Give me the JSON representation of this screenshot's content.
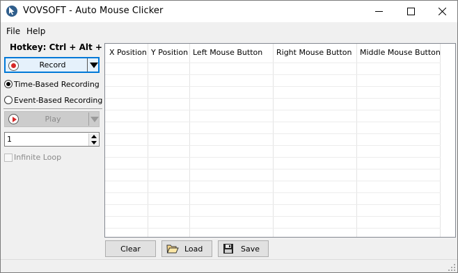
{
  "window": {
    "title": "VOVSOFT - Auto Mouse Clicker",
    "icon": "cursor-app-icon",
    "controls": [
      "minimize-icon",
      "maximize-icon",
      "close-icon"
    ]
  },
  "menu": {
    "file": "File",
    "help": "Help"
  },
  "left_panel": {
    "hotkey": "Hotkey: Ctrl + Alt + V",
    "record_label": "Record",
    "time_based": "Time-Based Recording",
    "event_based": "Event-Based Recording",
    "selected_mode": "Time-Based Recording",
    "play_label": "Play",
    "repeat_value": "1",
    "infinite_loop": "Infinite Loop",
    "infinite_loop_checked": false
  },
  "grid": {
    "columns": [
      "X Position",
      "Y Position",
      "Left Mouse Button",
      "Right Mouse Button",
      "Middle Mouse Button"
    ],
    "rows": []
  },
  "bottom": {
    "clear": "Clear",
    "load": "Load",
    "save": "Save"
  },
  "colors": {
    "accent": "#0078d7",
    "record": "#d62828",
    "disabled_text": "#8a8a8a"
  }
}
